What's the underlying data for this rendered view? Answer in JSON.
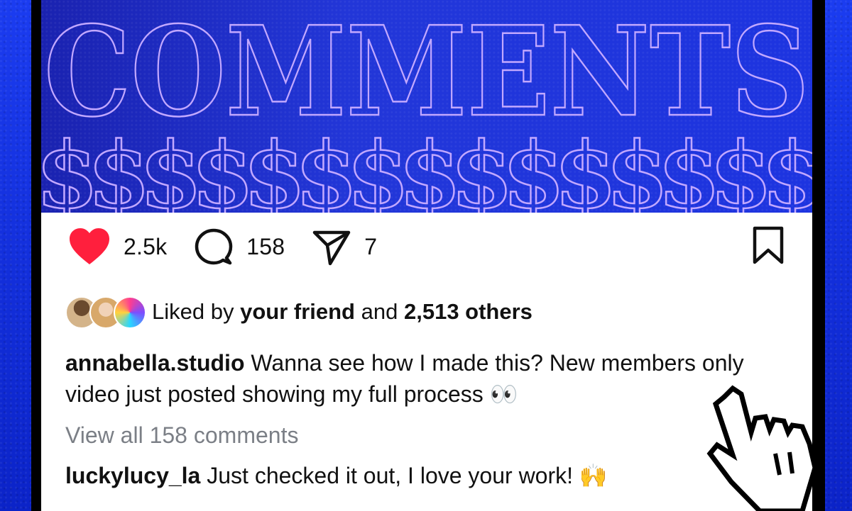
{
  "banner": {
    "headline": "COMMENTS",
    "symbol": "$",
    "colors": {
      "background": "#1d34e0",
      "outline": "#b9a2ff"
    }
  },
  "actions": {
    "likes": "2.5k",
    "comments": "158",
    "shares": "7",
    "like_color": "#ff1f3d"
  },
  "liked_by": {
    "prefix": "Liked by",
    "friend": "your friend",
    "and": "and",
    "others": "2,513 others"
  },
  "post": {
    "username": "annabella.studio",
    "caption": "Wanna see how I made this? New members only video just posted showing my full process 👀"
  },
  "view_all": "View all 158 comments",
  "top_comment": {
    "username": "luckylucy_la",
    "text": "Just checked it out, I love your work! 🙌"
  }
}
